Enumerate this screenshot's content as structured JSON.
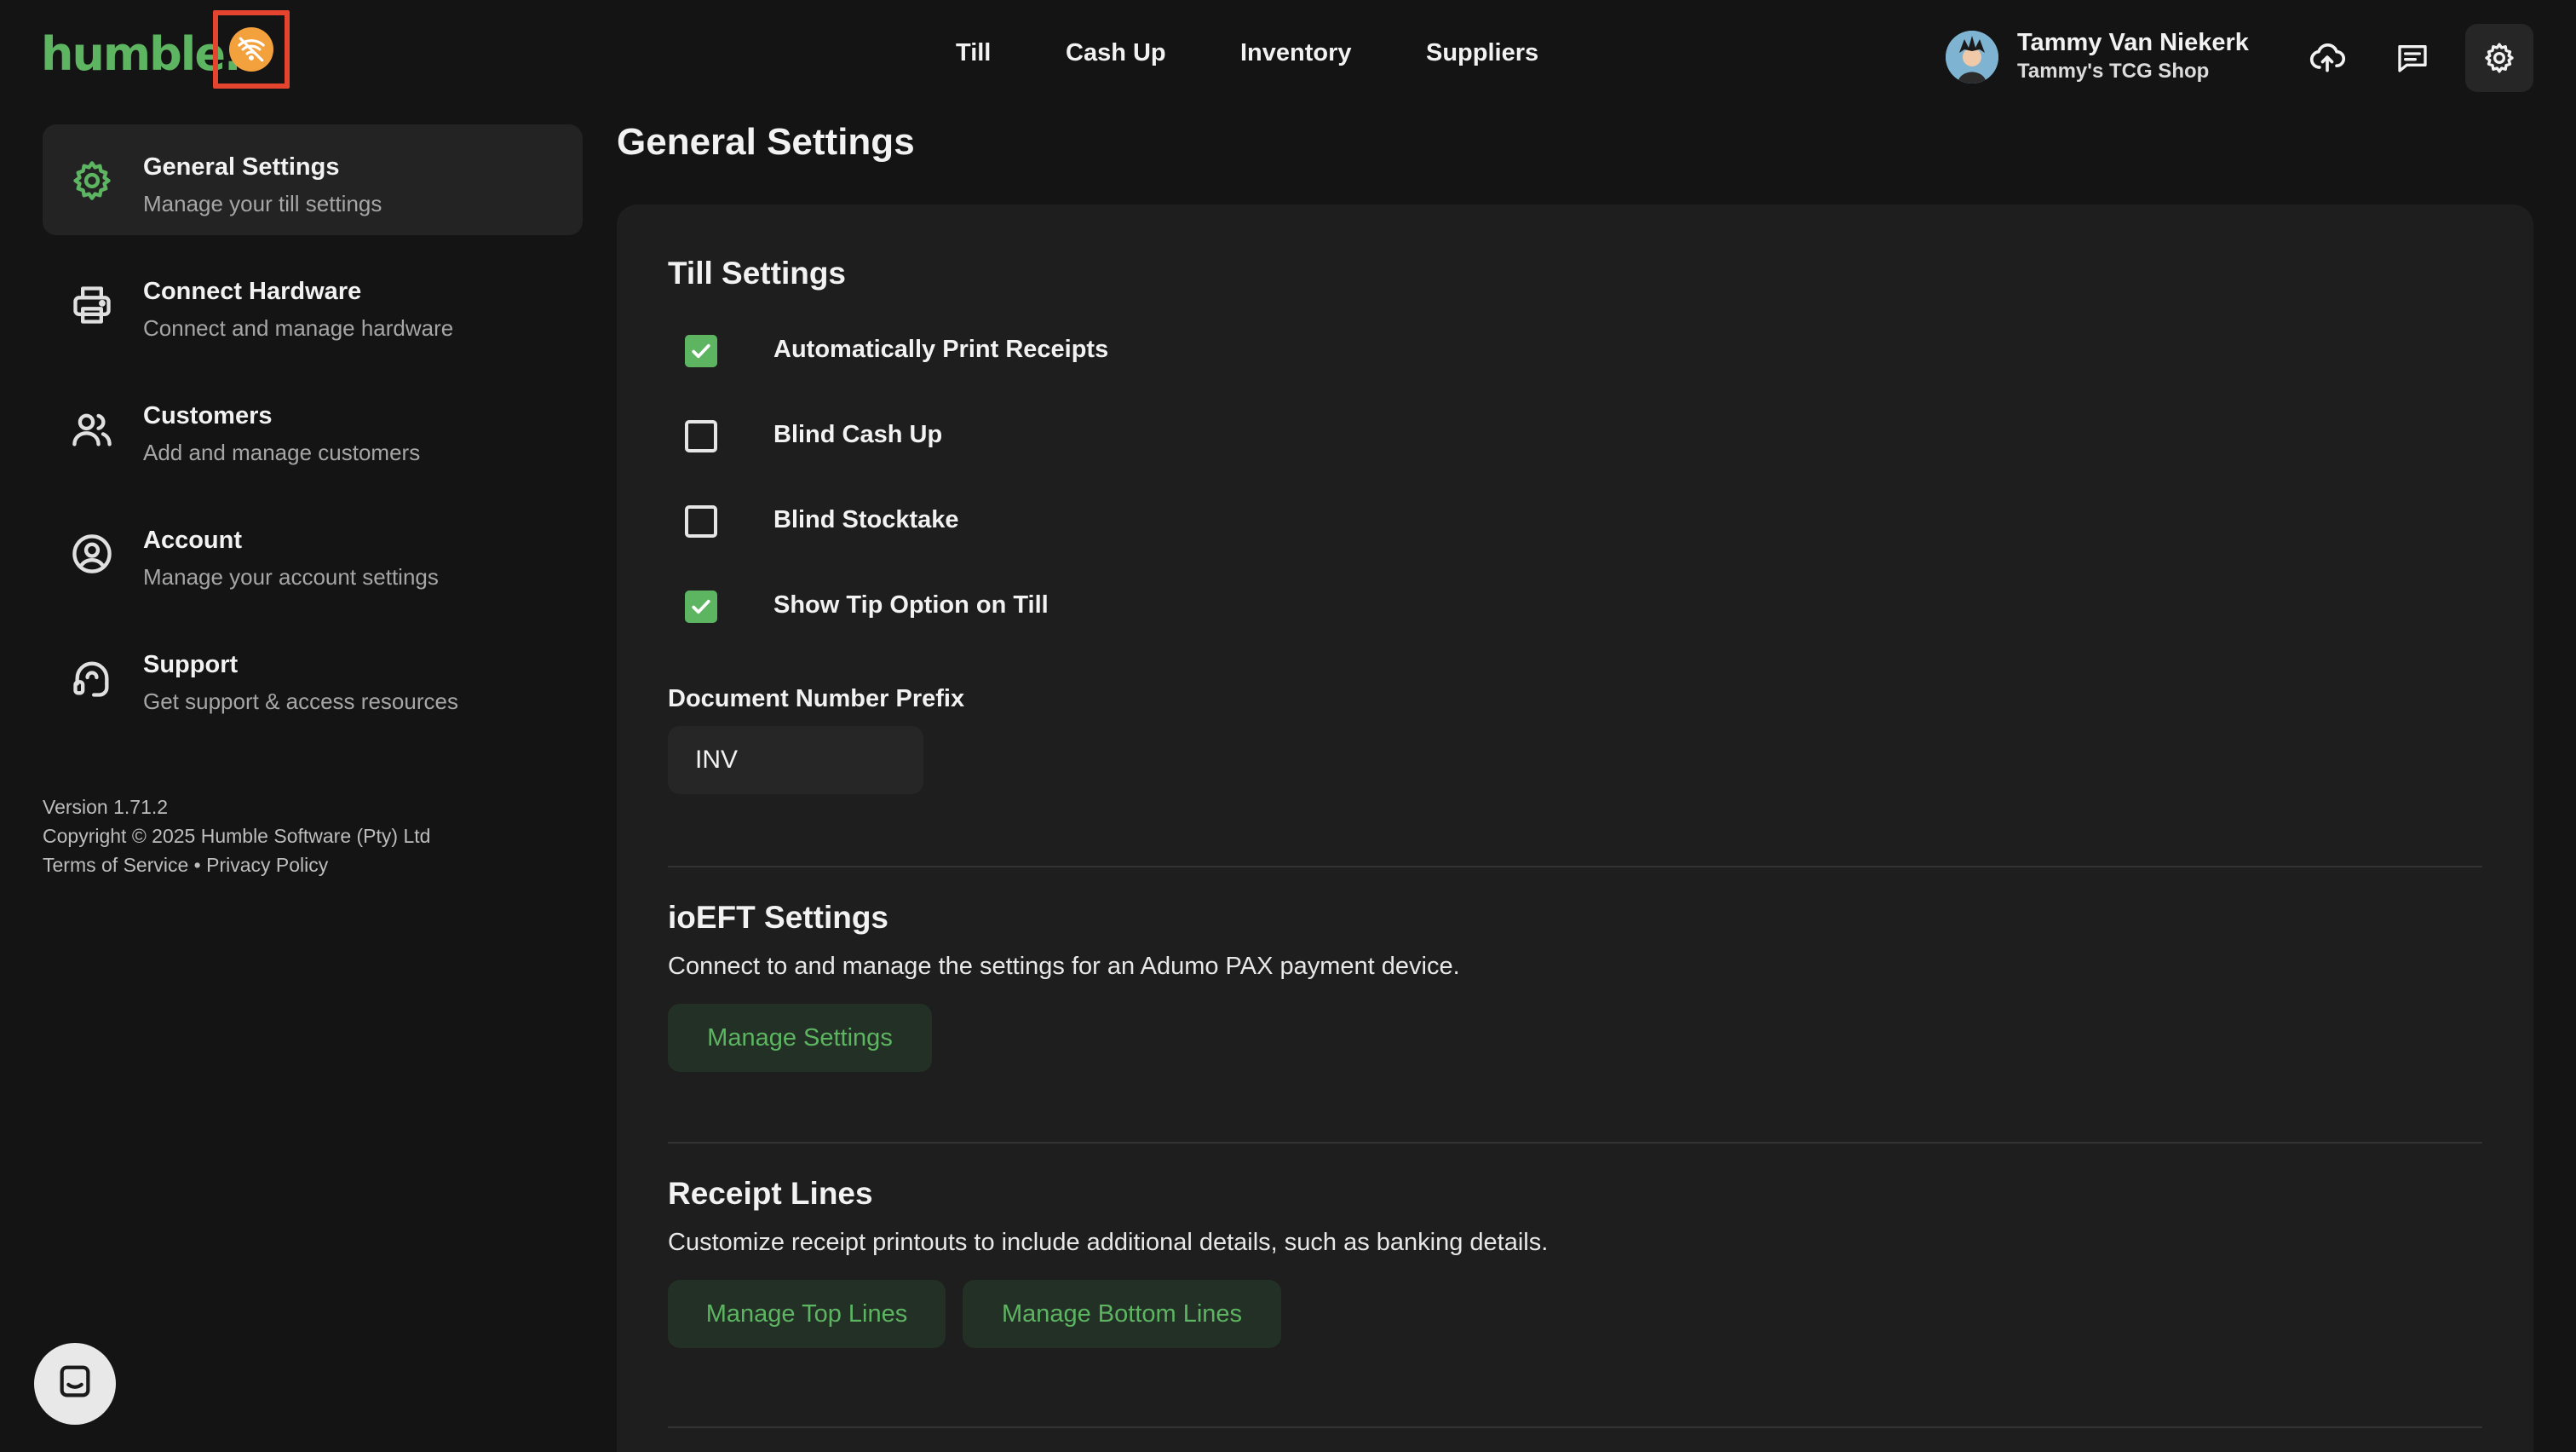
{
  "app": {
    "logo_text": "humble.",
    "colors": {
      "accent": "#5db562",
      "warning": "#f3a13d",
      "highlight": "#e5452f",
      "background": "#141414"
    }
  },
  "status_indicator": {
    "icon": "wifi-off-icon"
  },
  "nav": {
    "items": [
      {
        "label": "Till"
      },
      {
        "label": "Cash Up"
      },
      {
        "label": "Inventory"
      },
      {
        "label": "Suppliers"
      }
    ]
  },
  "user": {
    "name": "Tammy Van Niekerk",
    "shop": "Tammy's TCG Shop"
  },
  "toolbar": {
    "icons": [
      "cloud-upload-icon",
      "message-icon",
      "gear-icon"
    ]
  },
  "sidebar": {
    "items": [
      {
        "title": "General Settings",
        "subtitle": "Manage your till settings",
        "icon": "gear-icon",
        "active": true
      },
      {
        "title": "Connect Hardware",
        "subtitle": "Connect and manage hardware",
        "icon": "printer-icon",
        "active": false
      },
      {
        "title": "Customers",
        "subtitle": "Add and manage customers",
        "icon": "users-icon",
        "active": false
      },
      {
        "title": "Account",
        "subtitle": "Manage your account settings",
        "icon": "user-circle-icon",
        "active": false
      },
      {
        "title": "Support",
        "subtitle": "Get support & access resources",
        "icon": "headset-icon",
        "active": false
      }
    ],
    "footer": {
      "version": "Version 1.71.2",
      "copyright": "Copyright © 2025 Humble Software (Pty) Ltd",
      "terms": "Terms of Service",
      "separator": "•",
      "privacy": "Privacy Policy"
    }
  },
  "main": {
    "title": "General Settings",
    "till_settings": {
      "title": "Till Settings",
      "options": [
        {
          "label": "Automatically Print Receipts",
          "checked": true
        },
        {
          "label": "Blind Cash Up",
          "checked": false
        },
        {
          "label": "Blind Stocktake",
          "checked": false
        },
        {
          "label": "Show Tip Option on Till",
          "checked": true
        }
      ],
      "prefix_label": "Document Number Prefix",
      "prefix_value": "INV"
    },
    "ioeft": {
      "title": "ioEFT Settings",
      "description": "Connect to and manage the settings for an Adumo PAX payment device.",
      "button": "Manage Settings"
    },
    "receipt_lines": {
      "title": "Receipt Lines",
      "description": "Customize receipt printouts to include additional details, such as banking details.",
      "top_button": "Manage Top Lines",
      "bottom_button": "Manage Bottom Lines"
    }
  },
  "chat": {
    "icon": "chat-icon"
  }
}
